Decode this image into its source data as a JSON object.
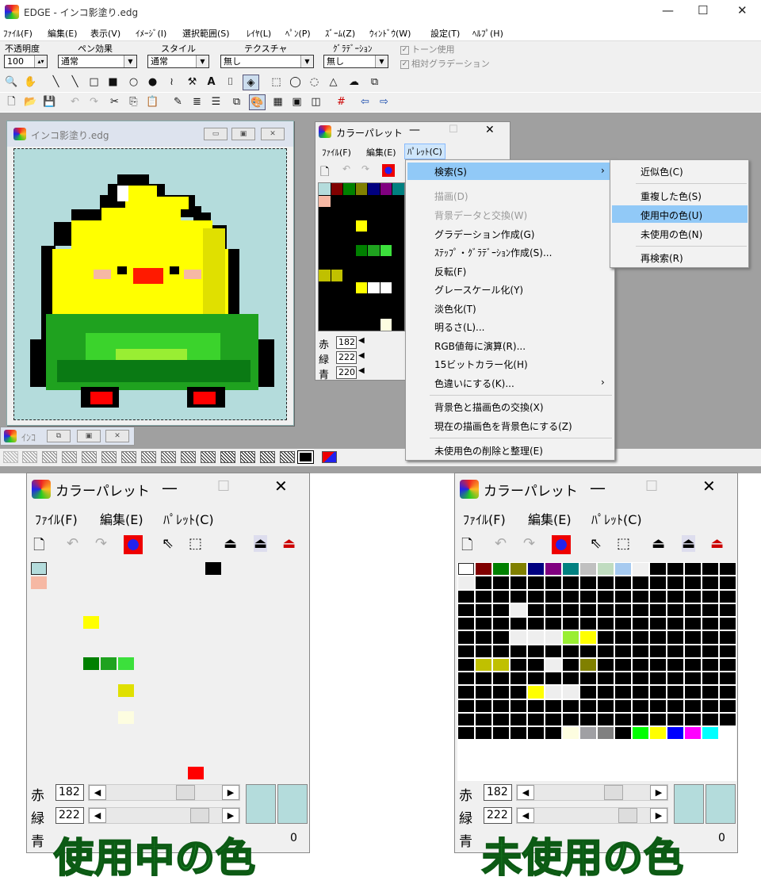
{
  "app": {
    "title": "EDGE - インコ影塗り.edg",
    "min": "—",
    "max": "☐",
    "close": "✕"
  },
  "menubar": [
    "ﾌｧｲﾙ(F)",
    "編集(E)",
    "表示(V)",
    "ｲﾒｰｼﾞ(I)",
    "選択範囲(S)",
    "ﾚｲﾔ(L)",
    "ﾍﾟﾝ(P)",
    "ｽﾞｰﾑ(Z)",
    "ｳｨﾝﾄﾞｳ(W)",
    "設定(T)",
    "ﾍﾙﾌﾟ(H)"
  ],
  "options": {
    "opacity_label": "不透明度",
    "opacity_value": "100",
    "pen_effect_label": "ペン効果",
    "pen_effect_value": "通常",
    "style_label": "スタイル",
    "style_value": "通常",
    "texture_label": "テクスチャ",
    "texture_value": "無し",
    "gradation_label": "ｸﾞﾗﾃﾞｰｼｮﾝ",
    "gradation_value": "無し",
    "tone_label": "トーン使用",
    "relgrad_label": "相対グラデーション"
  },
  "doc_window": {
    "title": "インコ影塗り.edg",
    "min_title": "ｲﾝｺ"
  },
  "small_palette": {
    "title": "カラーパレット",
    "menu": [
      "ﾌｧｲﾙ(F)",
      "編集(E)",
      "ﾊﾟﾚｯﾄ(C)"
    ],
    "r_label": "赤",
    "g_label": "緑",
    "b_label": "青",
    "r": "182",
    "g": "222",
    "b": "220"
  },
  "context_menu": {
    "items": [
      "検索(S)",
      "描画(D)",
      "背景データと交換(W)",
      "グラデーション作成(G)",
      "ｽﾃｯﾌﾟ・ｸﾞﾗﾃﾞｰｼｮﾝ作成(S)...",
      "反転(F)",
      "グレースケール化(Y)",
      "淡色化(T)",
      "明るさ(L)...",
      "RGB値毎に演算(R)...",
      "15ビットカラー化(H)",
      "色違いにする(K)...",
      "背景色と描画色の交換(X)",
      "現在の描画色を背景色にする(Z)",
      "未使用色の削除と整理(E)"
    ]
  },
  "submenu": {
    "items": [
      "近似色(C)",
      "重複した色(S)",
      "使用中の色(U)",
      "未使用の色(N)",
      "再検索(R)"
    ]
  },
  "palette_left": {
    "title": "カラーパレット",
    "menu": [
      "ﾌｧｲﾙ(F)",
      "編集(E)",
      "ﾊﾟﾚｯﾄ(C)"
    ],
    "r_label": "赤",
    "g_label": "緑",
    "b_label": "青",
    "r": "182",
    "g": "222",
    "zero": "0"
  },
  "palette_right": {
    "title": "カラーパレット",
    "menu": [
      "ﾌｧｲﾙ(F)",
      "編集(E)",
      "ﾊﾟﾚｯﾄ(C)"
    ],
    "r_label": "赤",
    "g_label": "緑",
    "b_label": "青",
    "r": "182",
    "g": "222",
    "zero": "0"
  },
  "captions": {
    "left": "使用中の色",
    "right": "未使用の色"
  },
  "colors": {
    "bg_canvas": "#b4dcdc",
    "highlight": "#91c9f7",
    "yellow": "#ffff00",
    "green": "#1fa21f",
    "red": "#ff0000"
  }
}
